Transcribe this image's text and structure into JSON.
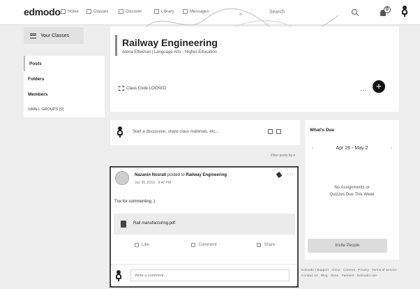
{
  "topbar": {
    "logo": "edmodo",
    "nav": [
      {
        "label": "Home",
        "icon": "home-icon"
      },
      {
        "label": "Classes",
        "icon": "classes-icon"
      },
      {
        "label": "Discover",
        "icon": "discover-icon"
      },
      {
        "label": "Library",
        "icon": "library-icon"
      },
      {
        "label": "Messages",
        "icon": "messages-icon"
      }
    ],
    "search_placeholder": "Search",
    "notification_count": "0"
  },
  "sidebar": {
    "your_classes": "Your Classes",
    "items": [
      {
        "label": "Posts"
      },
      {
        "label": "Folders"
      },
      {
        "label": "Members"
      },
      {
        "label": "SMALL GROUPS (0)"
      }
    ]
  },
  "class": {
    "title": "Railway Engineering",
    "subtitle": "Atena Eftekhari | Language Arts  - Higher Education",
    "code": "Class Code LOCKED",
    "more": "...",
    "add": "+"
  },
  "composer": {
    "placeholder": "Start a discussion, share class materials, etc..."
  },
  "filter_label": "Filter posts by",
  "post": {
    "author": "Nazanin Nosrati",
    "posted_to": "posted to",
    "class_name": "Railway Engineering",
    "meta": "Jun 05, 2019 · 9:47 PM ·",
    "more": "···",
    "text": "Tnx for commenting :)",
    "attachment": "Rail manufacturing.pdf",
    "actions": [
      {
        "label": "Like",
        "icon": "like-icon"
      },
      {
        "label": "Comment",
        "icon": "comment-icon"
      },
      {
        "label": "Share",
        "icon": "share-icon"
      }
    ],
    "reply_placeholder": "Write a comment..."
  },
  "due": {
    "title": "What's Due",
    "range": "Apr 26 - May 2",
    "prev": "‹",
    "next": "›",
    "empty_line1": "No Assignments or",
    "empty_line2": "Quizzes Due This Week",
    "invite": "Invite People"
  },
  "footer": {
    "links": "Edmodo ▪ Support · About · Careers · Privacy · Terms of Service · Contact Us · Blog · Store · Partners · Edmodo Live"
  }
}
